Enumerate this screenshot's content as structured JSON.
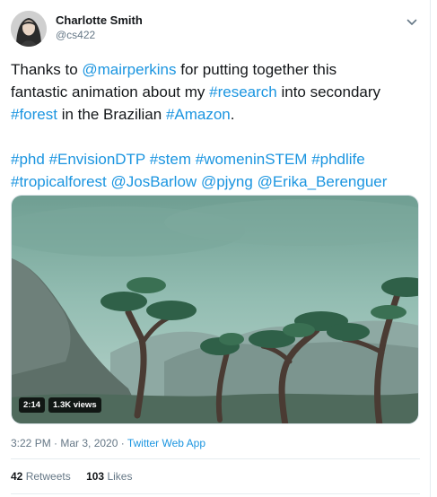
{
  "author": {
    "name": "Charlotte Smith",
    "handle": "@cs422"
  },
  "tweet": {
    "line1_pre": "Thanks to ",
    "mention1": "@mairperkins",
    "line1_post": " for putting together this",
    "line2_pre": "fantastic animation about my ",
    "tag_research": "#research",
    "line2_post": " into secondary",
    "tag_forest": "#forest",
    "line3_mid": " in the Brazilian ",
    "tag_amazon": "#Amazon",
    "line3_end": ".",
    "tags_line1": [
      "#phd",
      "#EnvisionDTP",
      "#stem",
      "#womeninSTEM",
      "#phdlife"
    ],
    "tags_line2": [
      "#tropicalforest",
      "@JosBarlow",
      "@pjyng",
      "@Erika_Berenguer"
    ]
  },
  "video": {
    "duration": "2:14",
    "views": "1.3K views"
  },
  "meta": {
    "timestamp": "3:22 PM · Mar 3, 2020 · ",
    "source": "Twitter Web App"
  },
  "stats": {
    "retweets_count": "42",
    "retweets_label": "Retweets",
    "likes_count": "103",
    "likes_label": "Likes"
  },
  "colors": {
    "link": "#1b95e0",
    "text": "#14171a",
    "muted": "#657786"
  },
  "icons": {
    "caret": "chevron-down-icon",
    "avatar": "avatar"
  }
}
